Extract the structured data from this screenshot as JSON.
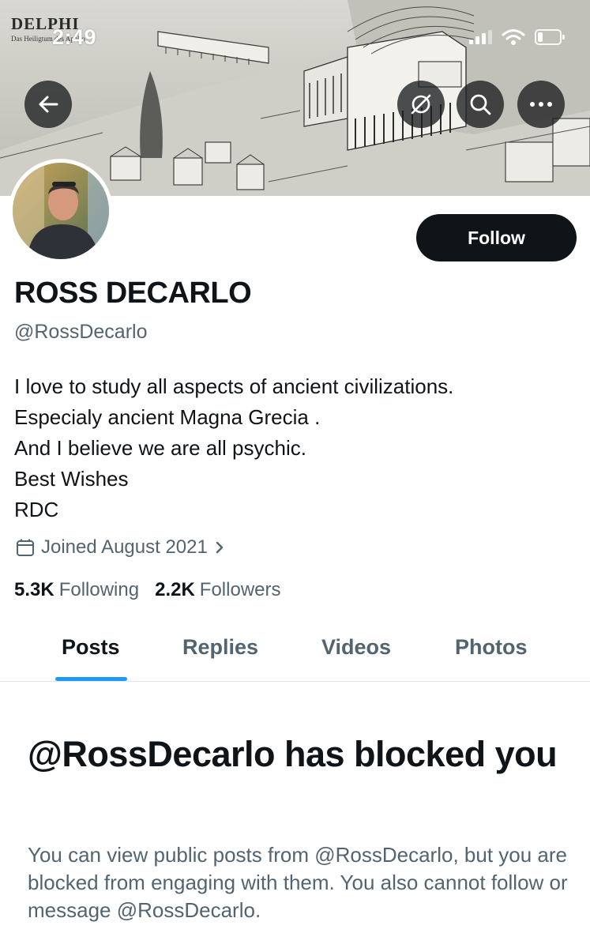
{
  "status_bar": {
    "time": "2:49"
  },
  "banner": {
    "title": "DELPHI",
    "subtitle": "Das Heiligtum des Apollo"
  },
  "profile": {
    "display_name": "ROSS DECARLO",
    "handle": "@RossDecarlo",
    "follow_label": "Follow",
    "bio_lines": [
      "I love to study all aspects of ancient civilizations.",
      "Especialy ancient Magna Grecia .",
      "And I believe we are all psychic.",
      "Best Wishes",
      "RDC"
    ],
    "joined": "Joined August 2021",
    "following_count": "5.3K",
    "following_label": "Following",
    "followers_count": "2.2K",
    "followers_label": "Followers"
  },
  "tabs": [
    {
      "label": "Posts",
      "active": true
    },
    {
      "label": "Replies",
      "active": false
    },
    {
      "label": "Videos",
      "active": false
    },
    {
      "label": "Photos",
      "active": false
    }
  ],
  "blocked": {
    "title": "@RossDecarlo has blocked you",
    "description": "You can view public posts from @RossDecarlo, but you are blocked from engaging with them. You also cannot follow or message @RossDecarlo."
  },
  "icons": {
    "back": "arrow-left-icon",
    "mute": "circle-slash-icon",
    "search": "search-icon",
    "more": "more-horizontal-icon",
    "calendar": "calendar-icon",
    "chevron": "chevron-right-icon"
  },
  "colors": {
    "accent": "#1d9bf0",
    "text_secondary": "#536471",
    "button_dark": "#0f1419"
  }
}
